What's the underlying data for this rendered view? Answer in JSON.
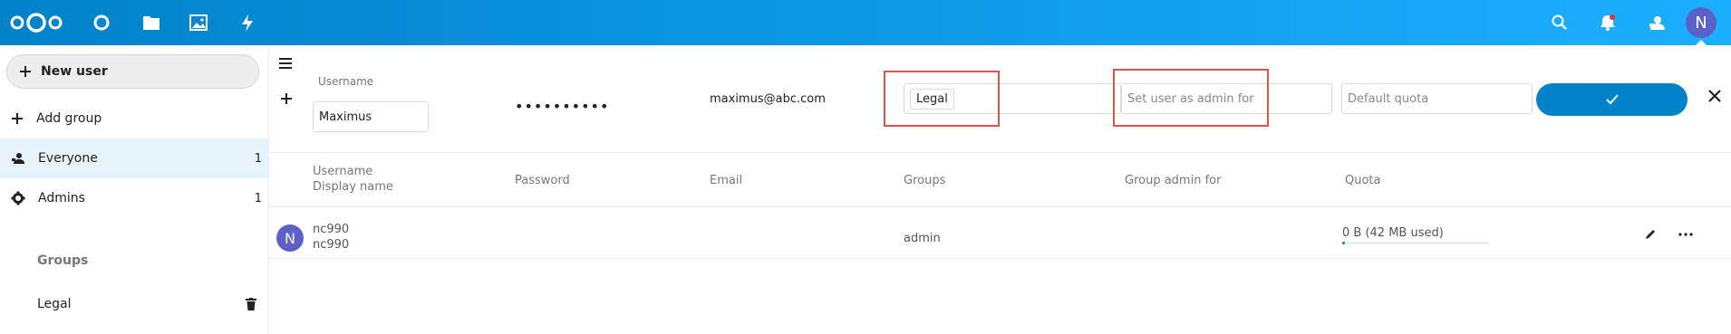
{
  "header": {
    "avatar_initial": "N",
    "icons": [
      "nextcloud-logo-icon",
      "dashboard-icon",
      "files-icon",
      "photos-icon",
      "activity-icon",
      "search-icon",
      "notifications-icon",
      "contacts-icon"
    ],
    "colors": {
      "gradient_start": "#0082c9",
      "gradient_end": "#1cafff"
    }
  },
  "sidebar": {
    "new_user_label": "New user",
    "add_group_label": "Add group",
    "items": [
      {
        "label": "Everyone",
        "count": "1",
        "icon": "group-icon"
      },
      {
        "label": "Admins",
        "count": "1",
        "icon": "gear-icon"
      }
    ],
    "groups_caption": "Groups",
    "groups": [
      {
        "label": "Legal",
        "icon": "trash-icon"
      }
    ]
  },
  "new_user_form": {
    "username_label": "Username",
    "username_value": "Maximus",
    "password_masked": "••••••••••",
    "email_value": "maximus@abc.com",
    "group_tag": "Legal",
    "admin_for_placeholder": "Set user as admin for",
    "quota_placeholder": "Default quota"
  },
  "table": {
    "headers": {
      "username": "Username",
      "display_name": "Display name",
      "password": "Password",
      "email": "Email",
      "groups": "Groups",
      "group_admin_for": "Group admin for",
      "quota": "Quota"
    },
    "rows": [
      {
        "avatar_initial": "N",
        "username": "nc990",
        "display_name": "nc990",
        "groups": "admin",
        "quota_text": "0 B (42 MB used)",
        "quota_fraction": 0.02
      }
    ]
  }
}
